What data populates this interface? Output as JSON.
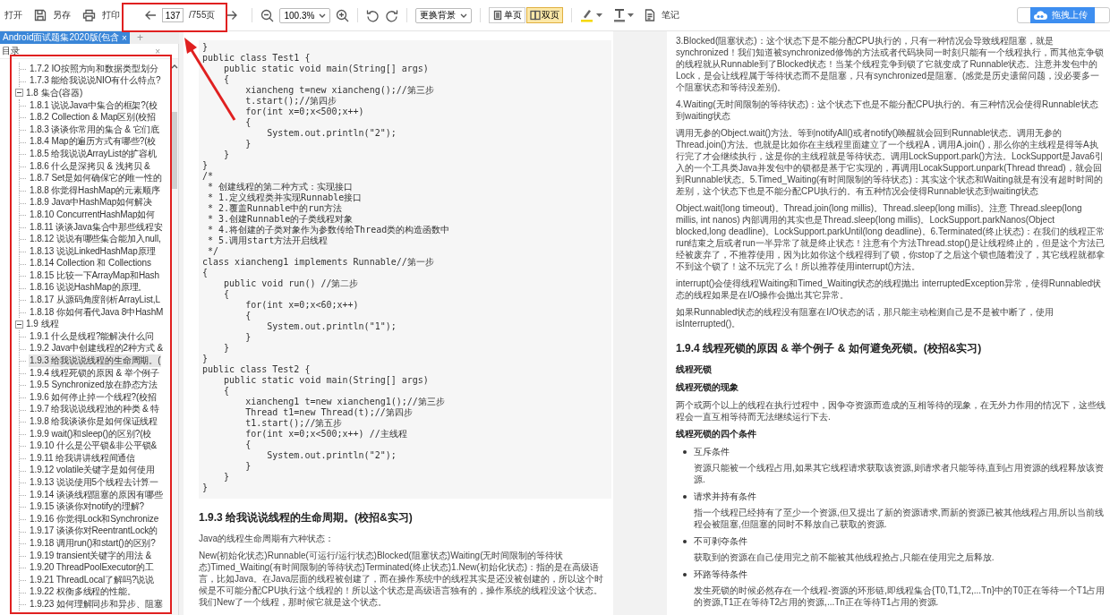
{
  "toolbar": {
    "open": "打开",
    "save_as": "另存",
    "print": "打印",
    "page_input": "137",
    "page_total": "/755页",
    "zoom": "100.3%",
    "background": "更换背景",
    "view_modes": [
      {
        "label": "单页",
        "kind": "single",
        "selected": false
      },
      {
        "label": "双页",
        "kind": "double",
        "selected": true
      }
    ],
    "note": "笔记",
    "upload": "拖拽上传"
  },
  "tabs": [
    {
      "label": "Android面试题集2020版(包含",
      "close": "×",
      "selected": true
    }
  ],
  "new_tab": "+",
  "outline": {
    "title": "目录",
    "close": "×",
    "items": [
      {
        "children": [
          {
            "label": "1.7.2 IO按照方向和数据类型划分",
            "selected": false
          },
          {
            "label": "1.7.3 能给我说说NIO有什么特点?",
            "selected": false
          }
        ]
      },
      {
        "label": "1.8 集合(容器)",
        "expanded": true,
        "children": [
          {
            "label": "1.8.1 说说Java中集合的框架?(校",
            "selected": false
          },
          {
            "label": "1.8.2 Collection & Map区别(校招",
            "selected": false
          },
          {
            "label": "1.8.3 谈谈你常用的集合 & 它们底",
            "selected": false
          },
          {
            "label": "1.8.4 Map的遍历方式有哪些?(校",
            "selected": false
          },
          {
            "label": "1.8.5 给我说说ArrayList的扩容机",
            "selected": false
          },
          {
            "label": "1.8.6 什么是深拷贝 & 浅拷贝 &",
            "selected": false
          },
          {
            "label": "1.8.7 Set是如何确保它的唯一性的",
            "selected": false
          },
          {
            "label": "1.8.8 你觉得HashMap的元素顺序",
            "selected": false
          },
          {
            "label": "1.8.9 Java中HashMap如何解决",
            "selected": false
          },
          {
            "label": "1.8.10 ConcurrentHashMap如何",
            "selected": false
          },
          {
            "label": "1.8.11 谈谈Java集合中那些线程安",
            "selected": false
          },
          {
            "label": "1.8.12 说说有哪些集合能加入null,",
            "selected": false
          },
          {
            "label": "1.8.13 说说LinkedHashMap原理",
            "selected": false
          },
          {
            "label": "1.8.14 Collection 和 Collections",
            "selected": false
          },
          {
            "label": "1.8.15 比较一下ArrayMap和Hash",
            "selected": false
          },
          {
            "label": "1.8.16 说说HashMap的原理。",
            "selected": false
          },
          {
            "label": "1.8.17 从源码角度剖析ArrayList,L",
            "selected": false
          },
          {
            "label": "1.8.18 你如何看代Java 8中HashM",
            "selected": false
          }
        ]
      },
      {
        "label": "1.9 线程",
        "expanded": true,
        "children": [
          {
            "label": "1.9.1 什么是线程?能解决什么问",
            "selected": false
          },
          {
            "label": "1.9.2 Java中创建线程的2种方式 &",
            "selected": false
          },
          {
            "label": "1.9.3 给我说说线程的生命周期。(",
            "selected": true
          },
          {
            "label": "1.9.4 线程死锁的原因 & 举个例子",
            "selected": false
          },
          {
            "label": "1.9.5 Synchronized放在静态方法",
            "selected": false
          },
          {
            "label": "1.9.6 如何停止掉一个线程?(校招",
            "selected": false
          },
          {
            "label": "1.9.7 给我说说线程池的种类 & 特",
            "selected": false
          },
          {
            "label": "1.9.8 给我谈谈你是如何保证线程",
            "selected": false
          },
          {
            "label": "1.9.9 wait()和sleep()的区别?(校",
            "selected": false
          },
          {
            "label": "1.9.10 什么是公平锁&非公平锁&",
            "selected": false
          },
          {
            "label": "1.9.11 给我讲讲线程间通信",
            "selected": false
          },
          {
            "label": "1.9.12 volatile关键字是如何使用",
            "selected": false
          },
          {
            "label": "1.9.13 说说使用5个线程去计算一",
            "selected": false
          },
          {
            "label": "1.9.14 谈谈线程阻塞的原因有哪些",
            "selected": false
          },
          {
            "label": "1.9.15 谈谈你对notify的理解?",
            "selected": false
          },
          {
            "label": "1.9.16 你觉得Lock和Synchronize",
            "selected": false
          },
          {
            "label": "1.9.17 谈谈你对ReentrantLock的",
            "selected": false
          },
          {
            "label": "1.9.18 调用run()和start()的区别?",
            "selected": false
          },
          {
            "label": "1.9.19 transient关键字的用法 &",
            "selected": false
          },
          {
            "label": "1.9.20 ThreadPoolExecutor的工",
            "selected": false
          },
          {
            "label": "1.9.21 ThreadLocal了解吗?说说",
            "selected": false
          },
          {
            "label": "1.9.22 权衡多线程的性能。",
            "selected": false
          },
          {
            "label": "1.9.23 如何理解同步和异步、阻塞",
            "selected": false
          }
        ]
      }
    ]
  },
  "left_page": {
    "code": [
      "}",
      "public class Test1 {",
      "    public static void main(String[] args)",
      "    {",
      "        xiancheng t=new xiancheng();//第三步",
      "        t.start();//第四步",
      "        for(int x=0;x<500;x++)",
      "        {",
      "            System.out.println(\"2\");",
      "        }",
      "    }",
      "}",
      "/*",
      " * 创建线程的第二种方式：实现接口",
      " * 1.定义线程类并实现Runnable接口",
      " * 2.覆盖Runnable中的run方法",
      " * 3.创建Runnable的子类线程对象",
      " * 4.将创建的子类对象作为参数传给Thread类的构造函数中",
      " * 5.调用start方法开启线程",
      " */",
      "class xiancheng1 implements Runnable//第一步",
      "{",
      "    public void run() //第二步",
      "    {",
      "        for(int x=0;x<60;x++)",
      "        {",
      "            System.out.println(\"1\");",
      "        }",
      "    }",
      "}",
      "public class Test2 {",
      "    public static void main(String[] args)",
      "    {",
      "        xiancheng1 t=new xiancheng1();//第三步",
      "        Thread t1=new Thread(t);//第四步",
      "        t1.start();//第五步",
      "        for(int x=0;x<500;x++) //主线程",
      "        {",
      "            System.out.println(\"2\");",
      "        }",
      "    }",
      "}"
    ],
    "heading": "1.9.3 给我说说线程的生命周期。(校招&实习)",
    "paragraphs": [
      "Java的线程生命周期有六种状态：",
      "New(初始化状态)Runnable(可运行/运行状态)Blocked(阻塞状态)Waiting(无时间限制的等待状态)Timed_Waiting(有时间限制的等待状态)Terminated(终止状态)1.New(初始化状态)：指的是在高级语言，比如Java。在Java层面的线程被创建了，而在操作系统中的线程其实是还没被创建的，所以这个时候是不可能分配CPU执行这个线程的！所以这个状态是高级语言独有的，操作系统的线程没这个状态。我们New了一个线程，那时候它就是这个状态。"
    ]
  },
  "right_page": {
    "blocks": [
      {
        "kind": "paragraph",
        "text": "3.Blocked(阻塞状态)：这个状态下是不能分配CPU执行的，只有一种情况会导致线程阻塞，就是synchronized！我们知道被synchronized修饰的方法或者代码块同一时刻只能有一个线程执行，而其他竞争锁的线程就从Runnable到了Blocked状态！当某个线程竞争到锁了它就变成了Runnable状态。注意并发包中的Lock，是会让线程属于等待状态而不是阻塞，只有synchronized是阻塞。(感觉是历史遗留问题，没必要多一个阻塞状态和等待没差别)。"
      },
      {
        "kind": "paragraph",
        "text": "4.Waiting(无时间限制的等待状态)：这个状态下也是不能分配CPU执行的。有三种情况会使得Runnable状态到waiting状态"
      },
      {
        "kind": "paragraph",
        "text": "调用无参的Object.wait()方法。等到notifyAll()或者notify()唤醒就会回到Runnable状态。调用无参的Thread.join()方法。也就是比如你在主线程里面建立了一个线程A，调用A.join()，那么你的主线程是得等A执行完了才会继续执行，这是你的主线程就是等待状态。调用LockSupport.park()方法。LockSupport是Java6引入的一个工具类Java并发包中的锁都是基于它实现的，再调用LocakSupport.unpark(Thread thread)，就会回到Runnable状态。5.Timed_Waiting(有时间限制的等待状态)：其实这个状态和Waiting就是有没有超时时间的差别，这个状态下也是不能分配CPU执行的。有五种情况会使得Runnable状态到waiting状态"
      },
      {
        "kind": "paragraph",
        "text": "Object.wait(long timeout)。Thread.join(long millis)。Thread.sleep(long millis)。注意 Thread.sleep(long millis, int nanos) 内部调用的其实也是Thread.sleep(long millis)。LockSupport.parkNanos(Object blocked,long deadline)。LockSupport.parkUntil(long deadline)。6.Terminated(终止状态)：在我们的线程正常run结束之后或者run一半异常了就是终止状态！注意有个方法Thread.stop()是让线程终止的，但是这个方法已经被废弃了，不推荐使用，因为比如你这个线程得到了锁，你stop了之后这个锁也随着没了，其它线程就都拿不到这个锁了！这不玩完了么！所以推荐使用interrupt()方法。"
      },
      {
        "kind": "paragraph",
        "text": "interrupt()会使得线程Waiting和Timed_Waiting状态的线程抛出 interruptedException异常，使得Runnabled状态的线程如果是在I/O操作会抛出其它异常。"
      },
      {
        "kind": "paragraph",
        "text": "如果Runnabled状态的线程没有阻塞在I/O状态的话，那只能主动检测自己是不是被中断了，使用isInterrupted()。"
      },
      {
        "kind": "heading",
        "text": "1.9.4 线程死锁的原因 & 举个例子 & 如何避免死锁。(校招&实习)"
      },
      {
        "kind": "label",
        "text": "线程死锁"
      },
      {
        "kind": "label",
        "text": "线程死锁的现象"
      },
      {
        "kind": "paragraph",
        "text": "两个或两个以上的线程在执行过程中，因争夺资源而造成的互相等待的现象，在无外力作用的情况下，这些线程会一直互相等待而无法继续运行下去."
      },
      {
        "kind": "label",
        "text": "线程死锁的四个条件"
      },
      {
        "kind": "bullet",
        "term": "互斥条件",
        "detail": "资源只能被一个线程占用,如果其它线程请求获取该资源,则请求者只能等待,直到占用资源的线程释放该资源."
      },
      {
        "kind": "bullet",
        "term": "请求并持有条件",
        "detail": "指一个线程已经持有了至少一个资源,但又提出了新的资源请求,而新的资源已被其他线程占用,所以当前线程会被阻塞,但阻塞的同时不释放自己获取的资源."
      },
      {
        "kind": "bullet",
        "term": "不可剥夺条件",
        "detail": "获取到的资源在自己使用完之前不能被其他线程抢占,只能在使用完之后释放."
      },
      {
        "kind": "bullet",
        "term": "环路等待条件",
        "detail": "发生死锁的时候必然存在一个线程-资源的环形链,即线程集合{T0,T1,T2,...Tn}中的T0正在等待一个T1占用的资源,T1正在等待T2占用的资源,...Tn正在等待T1占用的资源."
      }
    ]
  }
}
